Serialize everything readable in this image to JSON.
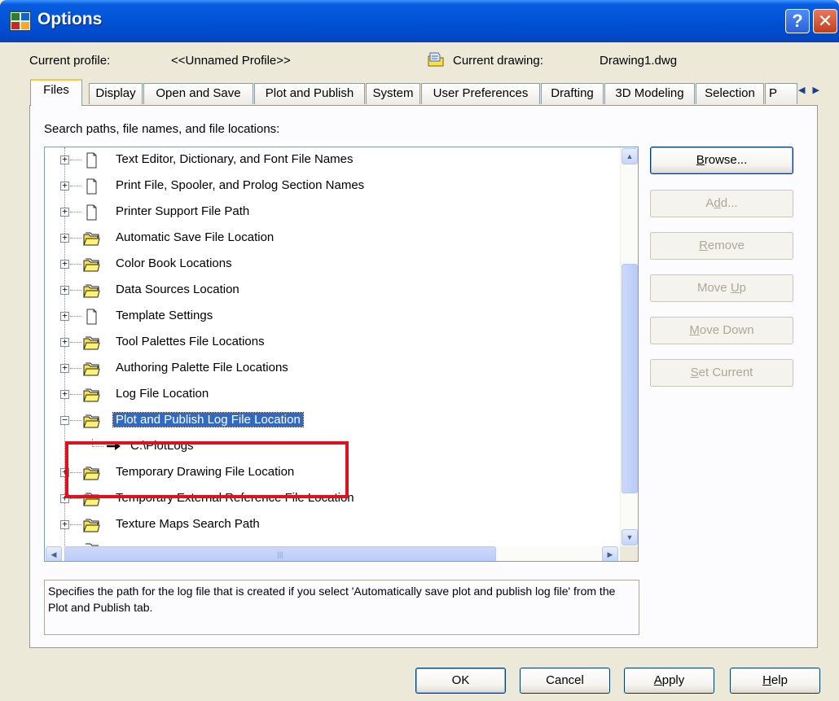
{
  "window": {
    "title": "Options"
  },
  "profile": {
    "current_profile_label": "Current profile:",
    "current_profile_value": "<<Unnamed Profile>>",
    "current_drawing_label": "Current drawing:",
    "current_drawing_value": "Drawing1.dwg"
  },
  "tabs": [
    {
      "label": "Files",
      "active": true
    },
    {
      "label": "Display"
    },
    {
      "label": "Open and Save"
    },
    {
      "label": "Plot and Publish"
    },
    {
      "label": "System"
    },
    {
      "label": "User Preferences"
    },
    {
      "label": "Drafting"
    },
    {
      "label": "3D Modeling"
    },
    {
      "label": "Selection"
    },
    {
      "label": "P"
    }
  ],
  "files": {
    "section_label": "Search paths, file names, and file locations:",
    "tree": [
      {
        "label": "Text Editor, Dictionary, and Font File Names",
        "icon": "file-icon"
      },
      {
        "label": "Print File, Spooler, and Prolog Section Names",
        "icon": "file-icon"
      },
      {
        "label": "Printer Support File Path",
        "icon": "file-icon"
      },
      {
        "label": "Automatic Save File Location",
        "icon": "folder-icon"
      },
      {
        "label": "Color Book Locations",
        "icon": "folder-icon"
      },
      {
        "label": "Data Sources Location",
        "icon": "folder-icon"
      },
      {
        "label": "Template Settings",
        "icon": "file-icon"
      },
      {
        "label": "Tool Palettes File Locations",
        "icon": "folder-icon"
      },
      {
        "label": "Authoring Palette File Locations",
        "icon": "folder-icon"
      },
      {
        "label": "Log File Location",
        "icon": "folder-icon"
      },
      {
        "label": "Plot and Publish Log File Location",
        "icon": "folder-icon",
        "selected": true,
        "expanded": true
      },
      {
        "label": "C:\\PlotLogs",
        "icon": "arrow-icon",
        "child": true
      },
      {
        "label": "Temporary Drawing File Location",
        "icon": "folder-icon"
      },
      {
        "label": "Temporary External Reference File Location",
        "icon": "folder-icon"
      },
      {
        "label": "Texture Maps Search Path",
        "icon": "folder-icon"
      }
    ],
    "description": "Specifies the path for the log file that is created if you select 'Automatically save plot and publish log file' from the Plot and Publish tab."
  },
  "side_buttons": {
    "browse": {
      "prefix": "",
      "mnemonic": "B",
      "rest": "rowse..."
    },
    "add": {
      "prefix": "A",
      "mnemonic": "d",
      "rest": "d..."
    },
    "remove": {
      "prefix": "",
      "mnemonic": "R",
      "rest": "emove"
    },
    "move_up": {
      "prefix": "Move ",
      "mnemonic": "U",
      "rest": "p"
    },
    "move_down": {
      "prefix": "",
      "mnemonic": "M",
      "rest": "ove Down"
    },
    "set_current": {
      "prefix": "",
      "mnemonic": "S",
      "rest": "et Current"
    }
  },
  "bottom_buttons": {
    "ok": "OK",
    "cancel": "Cancel",
    "apply": {
      "prefix": "",
      "mnemonic": "A",
      "rest": "pply"
    },
    "help": {
      "prefix": "",
      "mnemonic": "H",
      "rest": "elp"
    }
  },
  "colors": {
    "titlebar": "#0052d6",
    "selection": "#316ac5",
    "highlight_box": "#e0101c",
    "folder": "#f8e04a"
  }
}
